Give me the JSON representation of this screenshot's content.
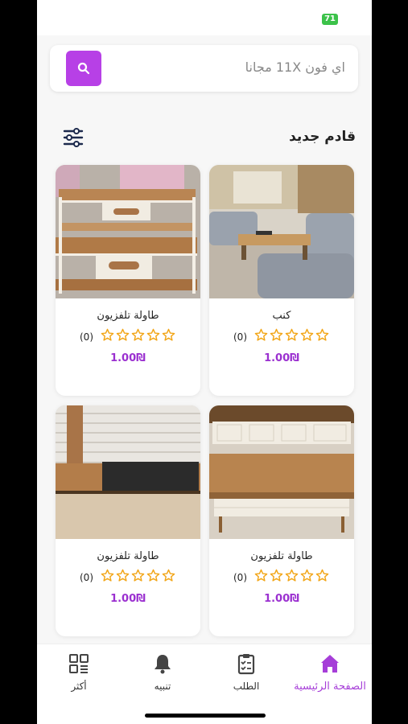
{
  "status": {
    "battery": "71"
  },
  "search": {
    "placeholder": "اي فون 11X مجانا",
    "icon": "search-icon"
  },
  "section": {
    "title": "قادم جديد",
    "filter_icon": "sliders-icon"
  },
  "products": [
    {
      "name": "كنب",
      "rating_count": "(0)",
      "price": "1.00₪",
      "stars": 0
    },
    {
      "name": "طاولة تلفزيون",
      "rating_count": "(0)",
      "price": "1.00₪",
      "stars": 0
    },
    {
      "name": "طاولة تلفزيون",
      "rating_count": "(0)",
      "price": "1.00₪",
      "stars": 0
    },
    {
      "name": "طاولة تلفزيون",
      "rating_count": "(0)",
      "price": "1.00₪",
      "stars": 0
    }
  ],
  "nav": {
    "home": "الصفحة الرئيسية",
    "orders": "الطلب",
    "alerts": "تنبيه",
    "more": "أكثر"
  },
  "colors": {
    "accent": "#b740e6",
    "price": "#9b30d0",
    "star": "#f2a516",
    "battery": "#3cc24a"
  }
}
